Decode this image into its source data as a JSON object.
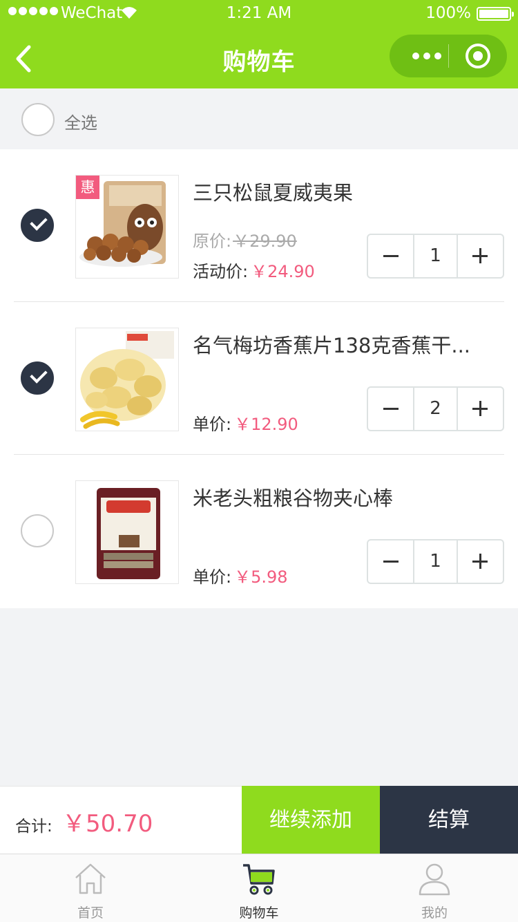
{
  "status_bar": {
    "carrier": "WeChat",
    "time": "1:21 AM",
    "battery": "100%"
  },
  "nav": {
    "title": "购物车"
  },
  "select_all": {
    "label": "全选"
  },
  "items": [
    {
      "name": "三只松鼠夏威夷果",
      "badge": "惠",
      "checked": true,
      "original_label": "原价:",
      "original_price": "￥29.90",
      "price_label": "活动价:",
      "price": "￥24.90",
      "qty": "1"
    },
    {
      "name": "名气梅坊香蕉片138克香蕉干...",
      "checked": true,
      "price_label": "单价:",
      "price": "￥12.90",
      "qty": "2"
    },
    {
      "name": "米老头粗粮谷物夹心棒",
      "checked": false,
      "price_label": "单价:",
      "price": "￥5.98",
      "qty": "1"
    }
  ],
  "checkout": {
    "total_label": "合计:",
    "total": "￥50.70",
    "add_label": "继续添加",
    "pay_label": "结算"
  },
  "tabs": [
    {
      "label": "首页",
      "icon": "home-icon"
    },
    {
      "label": "购物车",
      "icon": "cart-icon",
      "active": true
    },
    {
      "label": "我的",
      "icon": "user-icon"
    }
  ],
  "colors": {
    "brand_green": "#8fdb1e",
    "dark": "#2c3545",
    "price_pink": "#f25b7e"
  }
}
